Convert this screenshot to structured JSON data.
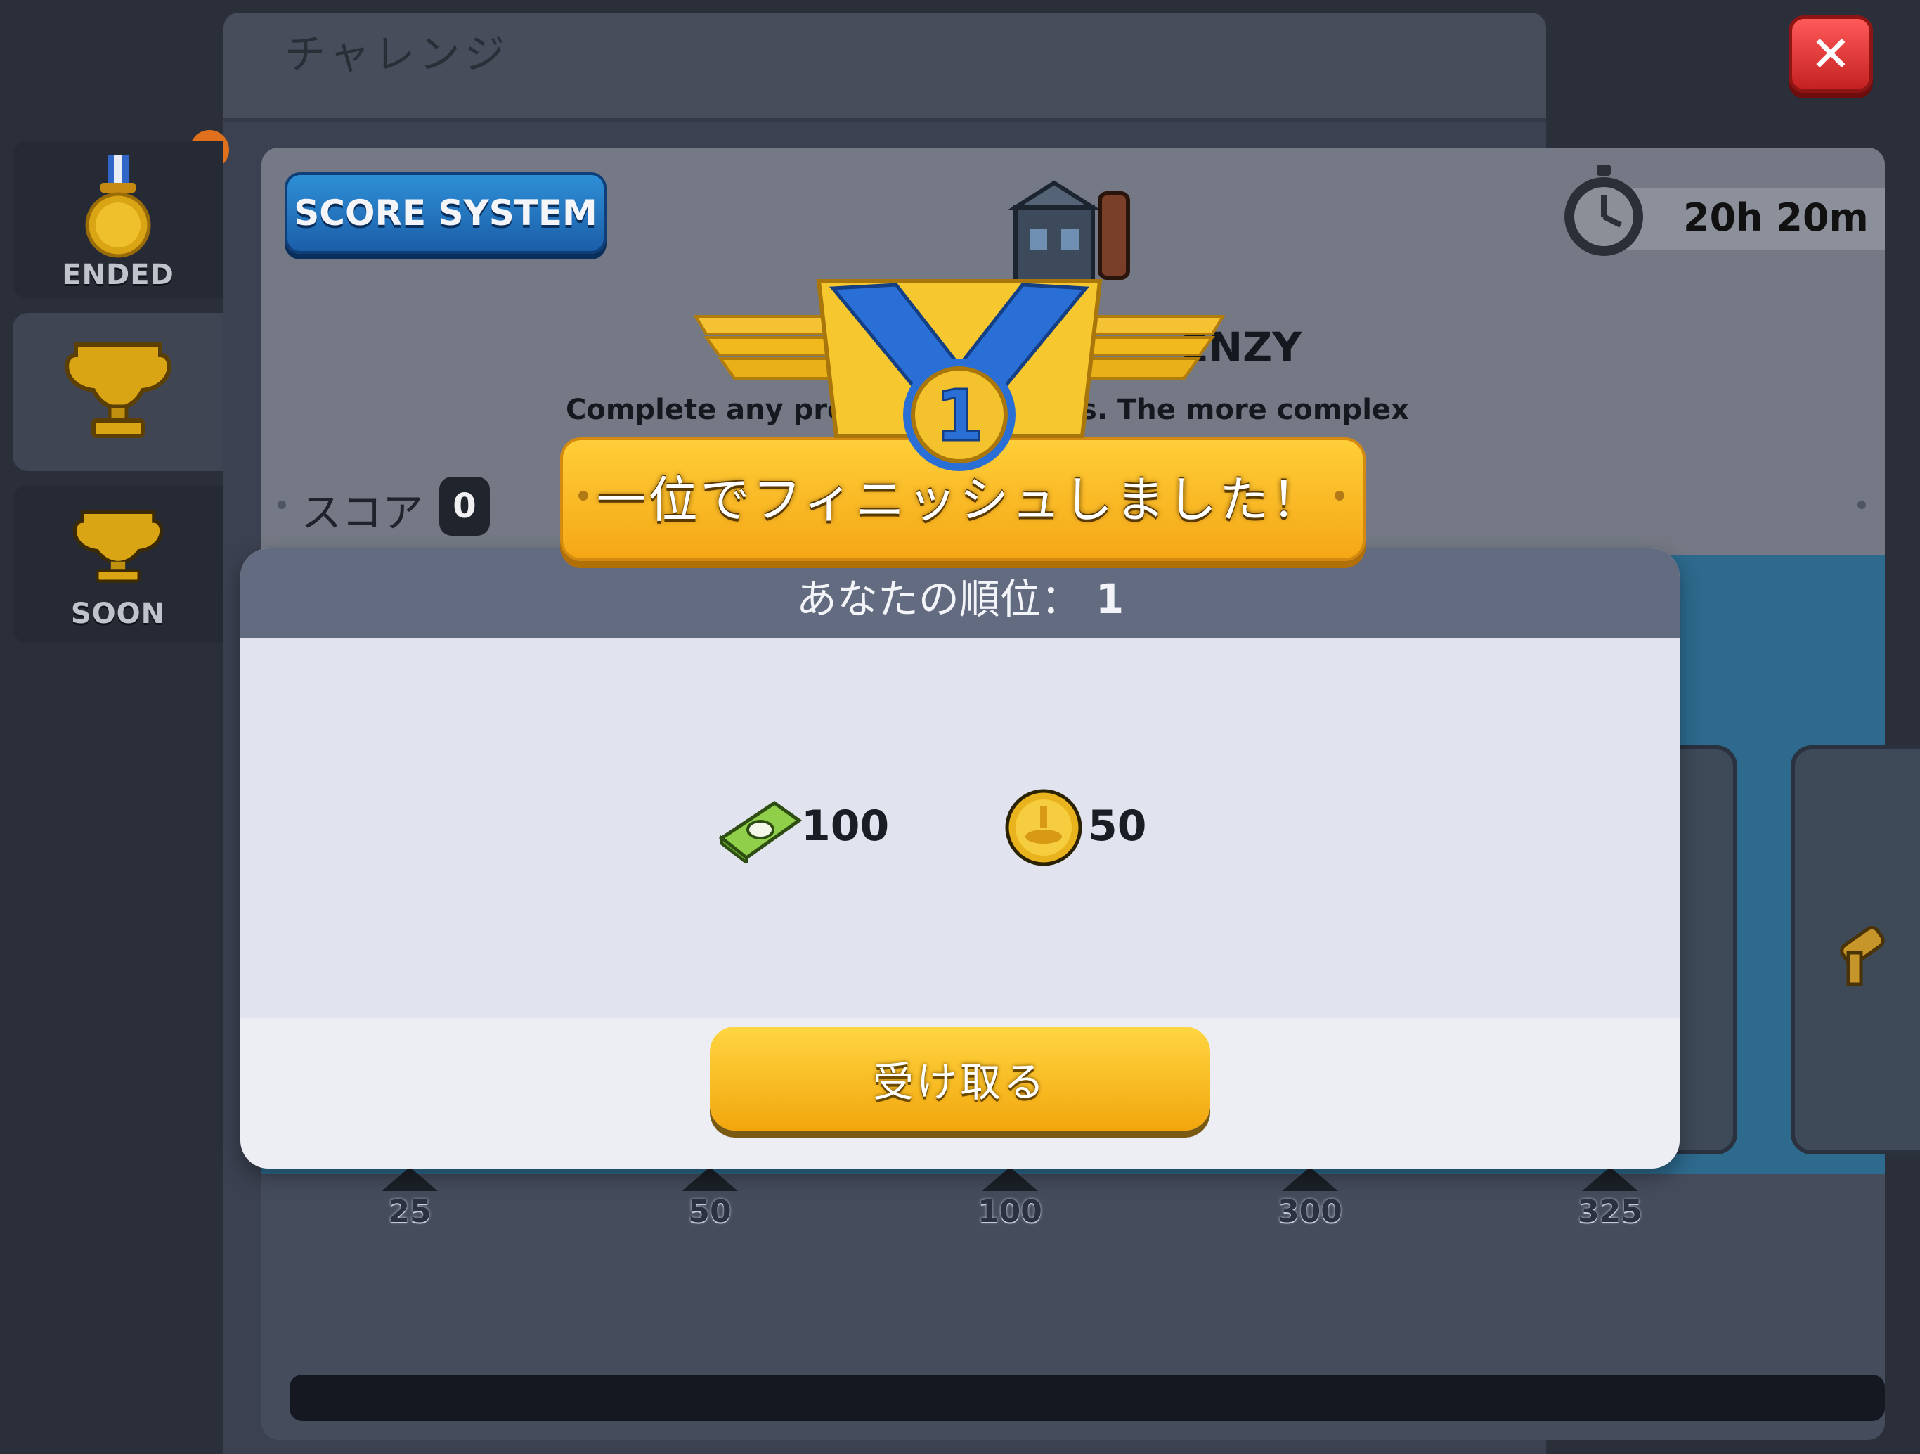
{
  "window": {
    "title": "チャレンジ"
  },
  "sidebar": {
    "tabs": [
      {
        "label": "ENDED",
        "icon": "medal-icon"
      },
      {
        "label": "",
        "icon": "trophy-icon"
      },
      {
        "label": "SOON",
        "icon": "trophy-icon"
      }
    ]
  },
  "event": {
    "score_system_label": "SCORE SYSTEM",
    "timer": "20h 20m",
    "title_visible": "ENZY",
    "description_visible": "Complete any prod                  vent factories. The more complex",
    "score_label": "スコア",
    "score_value": "0"
  },
  "milestones": [
    "25",
    "50",
    "100",
    "300",
    "325"
  ],
  "modal": {
    "banner_text": "一位でフィニッシュしました！",
    "medal_number": "1",
    "rank_label": "あなたの順位：",
    "rank_value": "1",
    "rewards": [
      {
        "icon": "cash-icon",
        "amount": "100"
      },
      {
        "icon": "coin-icon",
        "amount": "50"
      }
    ],
    "claim_button": "受け取る"
  },
  "colors": {
    "accent_gold": "#f5a716",
    "close_red": "#d92b2b",
    "score_blue": "#1f6db8"
  }
}
